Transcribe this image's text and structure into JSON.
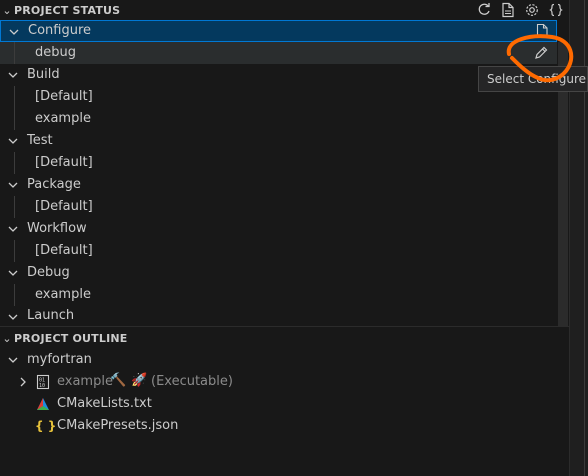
{
  "project_status": {
    "title": "PROJECT STATUS",
    "configure": {
      "label": "Configure",
      "preset": "debug"
    },
    "build": {
      "label": "Build",
      "items": [
        "[Default]",
        "example"
      ]
    },
    "test": {
      "label": "Test",
      "items": [
        "[Default]"
      ]
    },
    "package": {
      "label": "Package",
      "items": [
        "[Default]"
      ]
    },
    "workflow": {
      "label": "Workflow",
      "items": [
        "[Default]"
      ]
    },
    "debug": {
      "label": "Debug",
      "items": [
        "example"
      ]
    },
    "launch": {
      "label": "Launch"
    }
  },
  "tooltip": "Select Configure Pr",
  "project_outline": {
    "title": "PROJECT OUTLINE",
    "project": "myfortran",
    "target_name": "example",
    "target_type": "(Executable)",
    "files": [
      "CMakeLists.txt",
      "CMakePresets.json"
    ]
  },
  "colors": {
    "selection": "#04395e",
    "focus_border": "#0078d4",
    "annotation": "#ff6a00"
  }
}
